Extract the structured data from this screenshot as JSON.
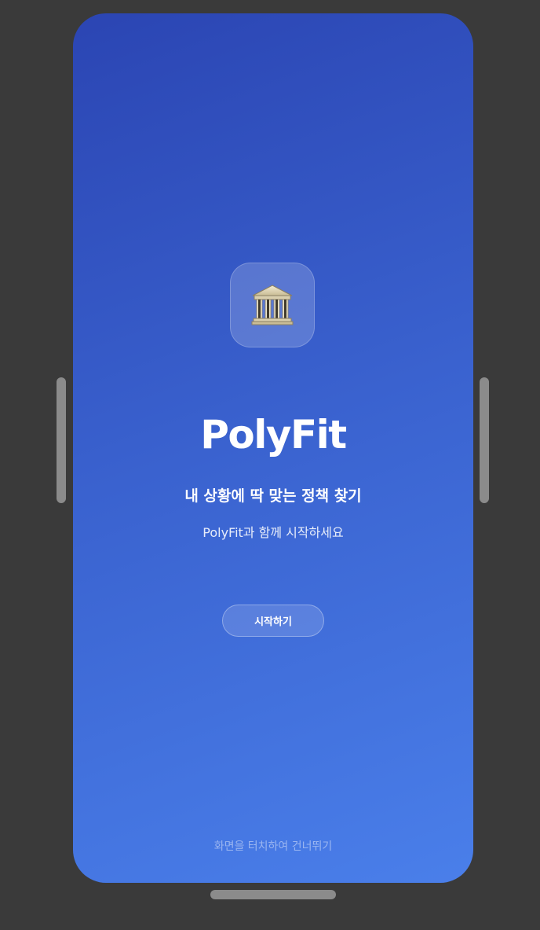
{
  "splash": {
    "icon": "classical-building-icon",
    "brand": "PolyFit",
    "tagline": "내 상황에 딱 맞는 정책 찾기",
    "subtext": "PolyFit과 함께 시작하세요",
    "start_label": "시작하기",
    "skip_hint": "화면을 터치하여 건너뛰기"
  },
  "colors": {
    "background": "#3a3a3a",
    "gradient_start": "#2b45b3",
    "gradient_end": "#4a7fea",
    "device_chrome": "#8b8b8b",
    "text": "#ffffff"
  }
}
